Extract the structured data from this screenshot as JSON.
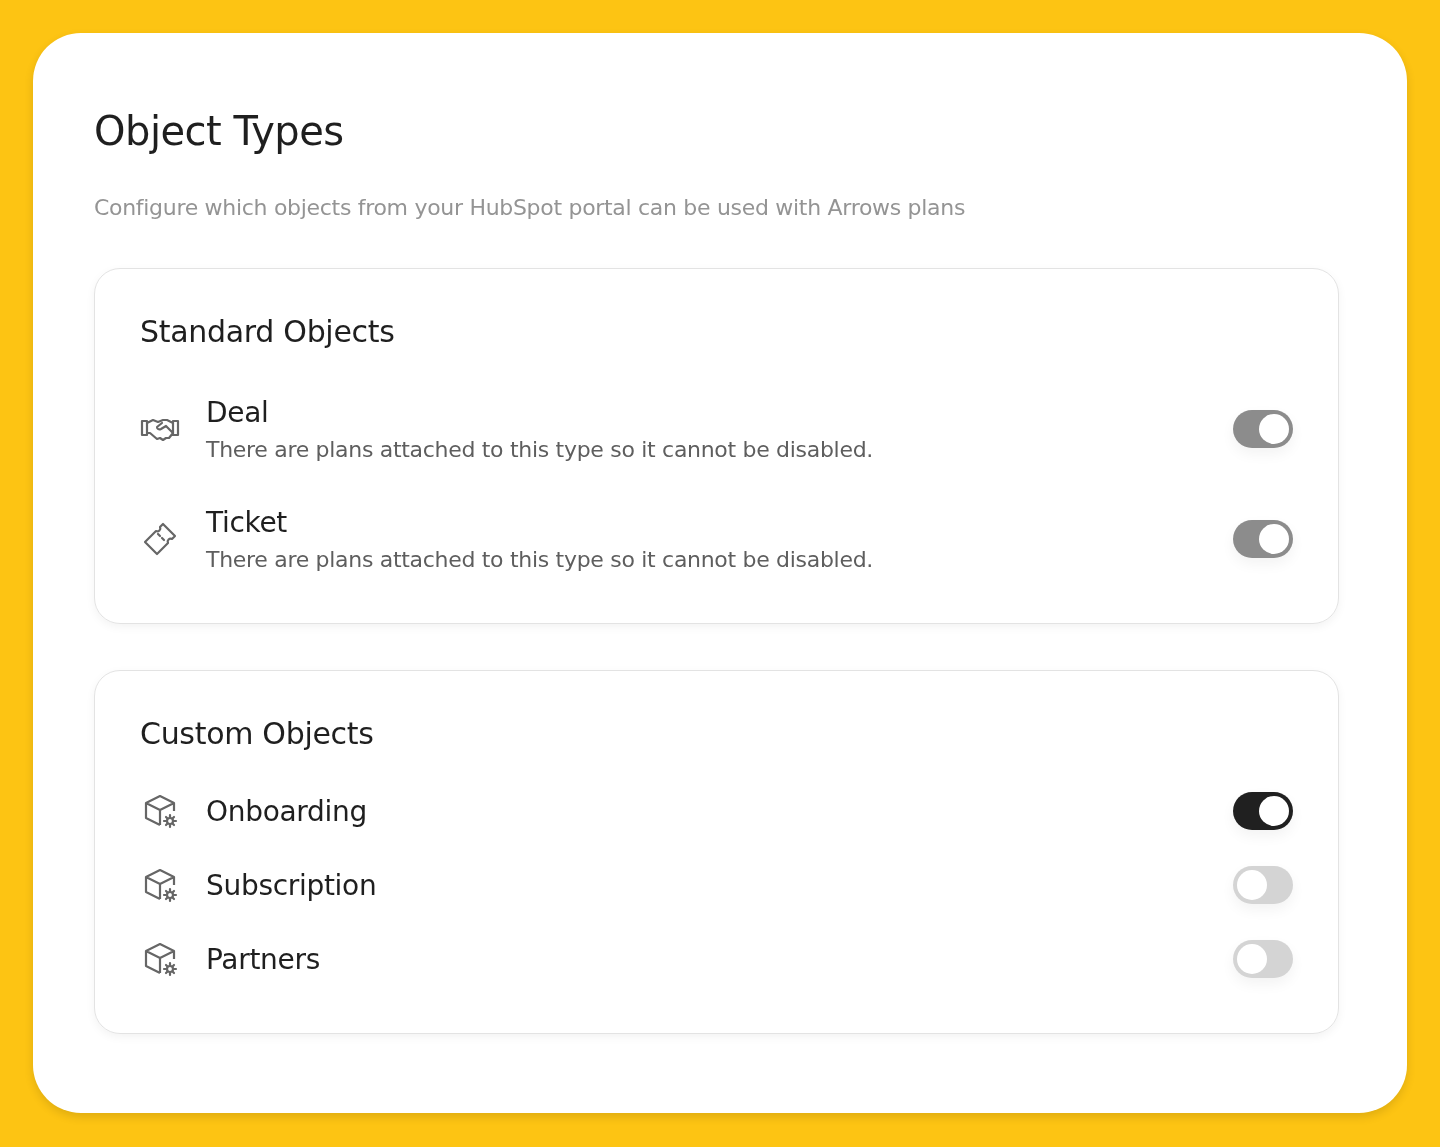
{
  "title": "Object Types",
  "subtitle": "Configure which objects from your HubSpot portal can be used with Arrows plans",
  "sections": [
    {
      "heading": "Standard Objects",
      "items": [
        {
          "kind": "deal",
          "name": "Deal",
          "note": "There are plans attached to this type so it cannot be disabled.",
          "on": true,
          "disabled": true
        },
        {
          "kind": "ticket",
          "name": "Ticket",
          "note": "There are plans attached to this type so it cannot be disabled.",
          "on": true,
          "disabled": true
        }
      ]
    },
    {
      "heading": "Custom Objects",
      "items": [
        {
          "kind": "custom",
          "name": "Onboarding",
          "on": true,
          "disabled": false
        },
        {
          "kind": "custom",
          "name": "Subscription",
          "on": false,
          "disabled": false
        },
        {
          "kind": "custom",
          "name": "Partners",
          "on": false,
          "disabled": false
        }
      ]
    }
  ]
}
